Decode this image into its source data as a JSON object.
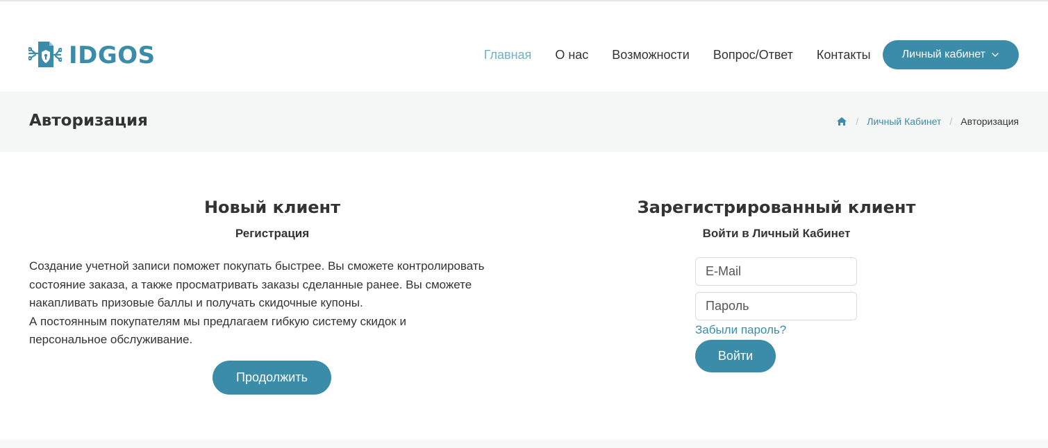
{
  "brand": {
    "name": "IDGOS",
    "color": "#3a8ca8"
  },
  "nav": {
    "items": [
      {
        "label": "Главная",
        "active": true
      },
      {
        "label": "О нас"
      },
      {
        "label": "Возможности"
      },
      {
        "label": "Вопрос/Ответ"
      },
      {
        "label": "Контакты"
      }
    ],
    "cabinet_button": "Личный кабинет",
    "cabinet_icon": "chevron-down-icon"
  },
  "page": {
    "title": "Авторизация",
    "breadcrumb": {
      "home_icon": "home-icon",
      "items": [
        "Личный Кабинет",
        "Авторизация"
      ]
    }
  },
  "new_client": {
    "title": "Новый клиент",
    "subtitle": "Регистрация",
    "lines": [
      "Создание учетной записи поможет покупать быстрее. Вы сможете контролировать",
      "состояние заказа, а также просматривать заказы сделанные ранее. Вы сможете",
      "накапливать призовые баллы и получать скидочные купоны.",
      "А постоянным покупателям мы предлагаем гибкую систему скидок и",
      "персональное обслуживание."
    ],
    "continue_button": "Продолжить"
  },
  "registered_client": {
    "title": "Зарегистрированный клиент",
    "subtitle": "Войти в Личный Кабинет",
    "email_placeholder": "E-Mail",
    "password_placeholder": "Пароль",
    "forgot_link": "Забыли пароль?",
    "login_button": "Войти"
  },
  "colors": {
    "accent": "#3a8ca8",
    "nav_active": "#6ab4c8",
    "title_bar_bg": "#f5f7f7"
  }
}
